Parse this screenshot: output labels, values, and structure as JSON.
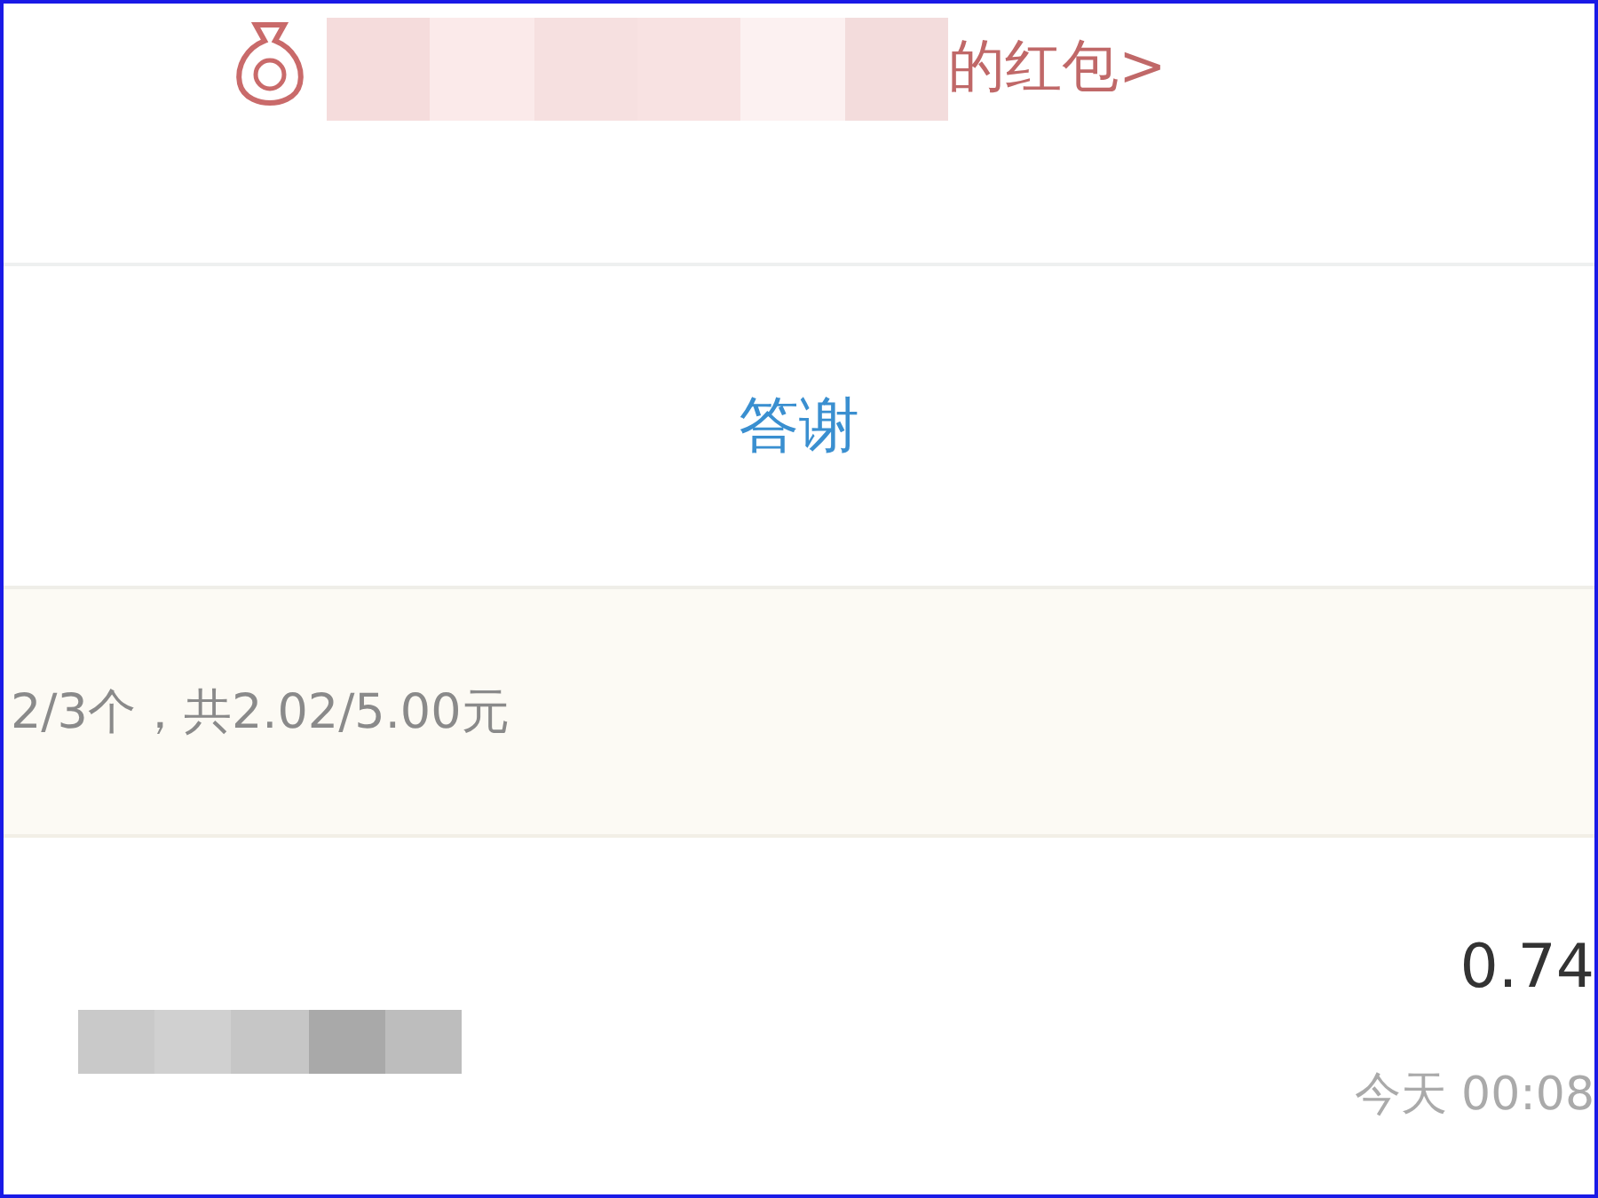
{
  "header": {
    "link": "的红包>"
  },
  "thank_button": {
    "label": "答谢"
  },
  "summary": {
    "text": "2/3个，共2.02/5.00元"
  },
  "records": [
    {
      "amount": "0.74",
      "time": "今天 00:08"
    }
  ]
}
